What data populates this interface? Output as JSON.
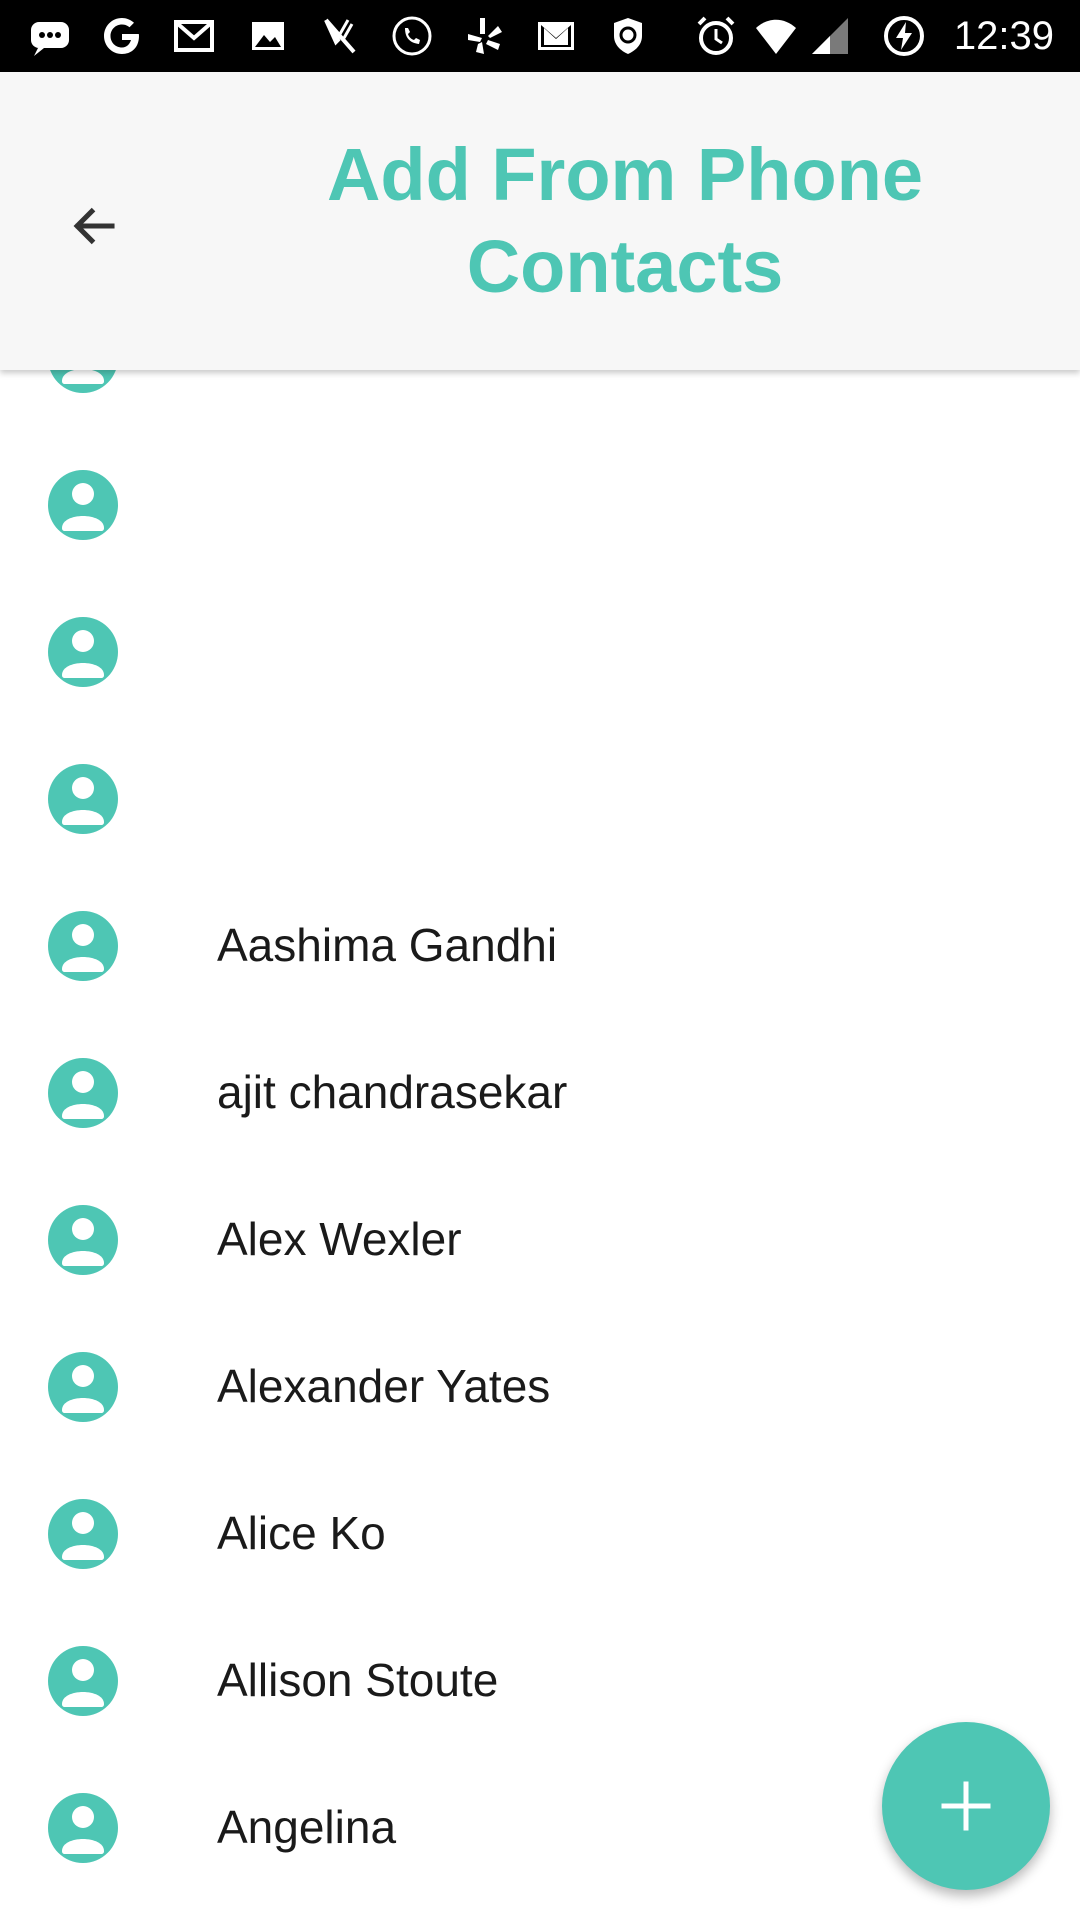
{
  "status_bar": {
    "time": "12:39",
    "icons": [
      "messages-icon",
      "google-icon",
      "gmail-icon",
      "gallery-icon",
      "food-delivery-icon",
      "phone-call-icon",
      "yelp-icon",
      "mail-icon",
      "shield-icon",
      "alarm-icon",
      "wifi-icon",
      "cell-signal-icon",
      "battery-charging-icon"
    ]
  },
  "header": {
    "title": "Add From Phone Contacts",
    "back_icon": "arrow-back-icon"
  },
  "contacts": [
    {
      "name": ""
    },
    {
      "name": ""
    },
    {
      "name": ""
    },
    {
      "name": ""
    },
    {
      "name": "Aashima Gandhi"
    },
    {
      "name": "ajit chandrasekar"
    },
    {
      "name": "Alex Wexler"
    },
    {
      "name": "Alexander Yates"
    },
    {
      "name": "Alice Ko"
    },
    {
      "name": "Allison Stoute"
    },
    {
      "name": "Angelina"
    }
  ],
  "fab": {
    "icon": "plus-icon"
  },
  "colors": {
    "accent": "#4ec6b4",
    "app_bar_background": "#f7f7f7",
    "status_bar_background": "#000000",
    "text": "#1a1a1a"
  }
}
